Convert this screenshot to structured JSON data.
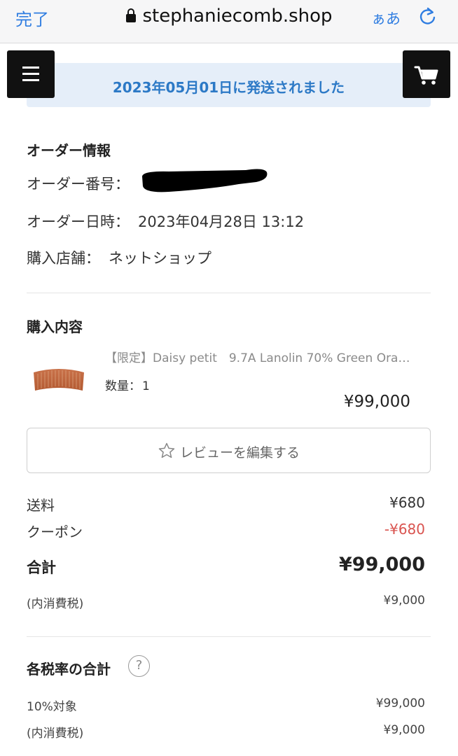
{
  "browser": {
    "done_label": "完了",
    "url": "stephaniecomb.shop",
    "text_size_label": "ぁあ"
  },
  "banner": {
    "shipped_text": "2023年05月01日に発送されました"
  },
  "order_info": {
    "title": "オーダー情報",
    "order_number_label": "オーダー番号：",
    "order_date_label": "オーダー日時：",
    "order_date_value": "2023年04月28日 13:12",
    "store_label": "購入店舗：",
    "store_value": "ネットショップ"
  },
  "purchase": {
    "title": "購入内容",
    "product_name": "【限定】Daisy petit　9.7A Lanolin 70% Green Ora…",
    "quantity_label": "数量：",
    "quantity_value": "1",
    "price": "¥99,000",
    "review_button_label": "レビューを編集する"
  },
  "summary": {
    "shipping_label": "送料",
    "shipping_value": "¥680",
    "coupon_label": "クーポン",
    "coupon_value": "-¥680",
    "total_label": "合計",
    "total_value": "¥99,000",
    "tax_label": "(内消費税)",
    "tax_value": "¥9,000"
  },
  "tax_rates": {
    "title": "各税率の合計",
    "help_symbol": "?",
    "rate_label": "10%対象",
    "rate_value": "¥99,000",
    "tax_label": "(内消費税)",
    "tax_value": "¥9,000"
  },
  "colors": {
    "accent_blue": "#2c79c6",
    "banner_bg": "#e5eef9",
    "coupon_red": "#d9534f",
    "button_black": "#111111"
  },
  "icons": [
    "lock-icon",
    "reload-icon",
    "hamburger-menu-icon",
    "cart-icon",
    "star-outline-icon",
    "help-circle-icon"
  ]
}
